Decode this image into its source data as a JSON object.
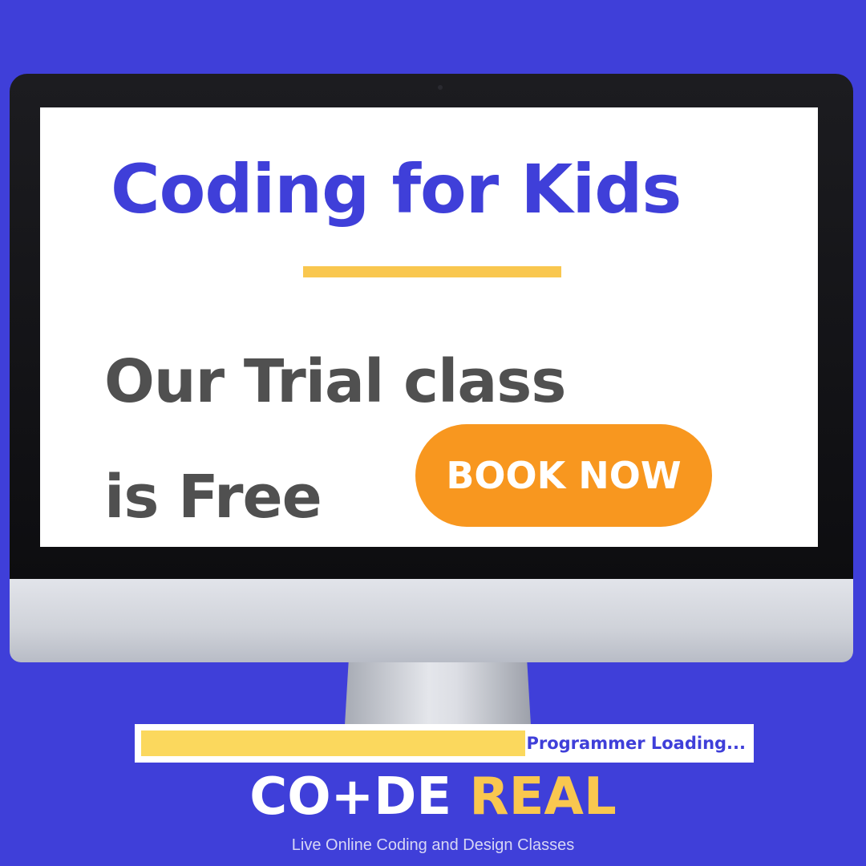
{
  "screen": {
    "headline": "Coding for Kids",
    "offer_line1": "Our Trial class",
    "offer_line2": "is Free",
    "cta_label": "BOOK NOW"
  },
  "loading": {
    "label": "Programmer Loading...",
    "progress_fraction": 0.62
  },
  "brand": {
    "logo_part1": "CO+DE",
    "logo_part2": "REAL",
    "tagline": "Live Online Coding and Design Classes"
  },
  "colors": {
    "background": "#3f3fd9",
    "headline": "#3f3fd9",
    "accent_yellow": "#f9c74f",
    "cta_orange": "#f8971f",
    "body_text": "#505050"
  }
}
